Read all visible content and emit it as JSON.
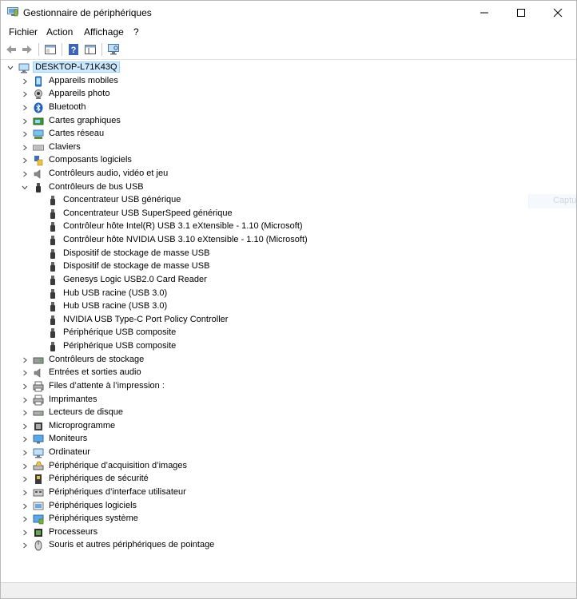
{
  "window": {
    "title": "Gestionnaire de périphériques"
  },
  "menu": [
    "Fichier",
    "Action",
    "Affichage",
    "?"
  ],
  "toolbar": [
    "back-arrow-icon",
    "forward-arrow-icon",
    "properties-icon",
    "help-icon",
    "view-icon",
    "monitor-scan-icon"
  ],
  "tree": {
    "root": "DESKTOP-L71K43Q",
    "categories_before": [
      {
        "label": "Appareils mobiles",
        "icon": "mobile-device-icon"
      },
      {
        "label": "Appareils photo",
        "icon": "camera-icon"
      },
      {
        "label": "Bluetooth",
        "icon": "bluetooth-icon"
      },
      {
        "label": "Cartes graphiques",
        "icon": "display-adapter-icon"
      },
      {
        "label": "Cartes réseau",
        "icon": "network-adapter-icon"
      },
      {
        "label": "Claviers",
        "icon": "keyboard-icon"
      },
      {
        "label": "Composants logiciels",
        "icon": "software-component-icon"
      },
      {
        "label": "Contrôleurs audio, vidéo et jeu",
        "icon": "speaker-icon"
      }
    ],
    "expanded": {
      "label": "Contrôleurs de bus USB",
      "icon": "usb-icon"
    },
    "usb_children": [
      "Concentrateur USB générique",
      "Concentrateur USB SuperSpeed générique",
      "Contrôleur hôte Intel(R) USB 3.1 eXtensible - 1.10 (Microsoft)",
      "Contrôleur hôte NVIDIA USB 3.10 eXtensible - 1.10 (Microsoft)",
      "Dispositif de stockage de masse USB",
      "Dispositif de stockage de masse USB",
      "Genesys Logic USB2.0 Card Reader",
      "Hub USB racine (USB 3.0)",
      "Hub USB racine (USB 3.0)",
      "NVIDIA USB Type-C Port Policy Controller",
      "Périphérique USB composite",
      "Périphérique USB composite"
    ],
    "categories_after": [
      {
        "label": "Contrôleurs de stockage",
        "icon": "storage-controller-icon"
      },
      {
        "label": "Entrées et sorties audio",
        "icon": "speaker-icon"
      },
      {
        "label": "Files d’attente à l’impression :",
        "icon": "printer-icon"
      },
      {
        "label": "Imprimantes",
        "icon": "printer-icon"
      },
      {
        "label": "Lecteurs de disque",
        "icon": "disk-drive-icon"
      },
      {
        "label": "Microprogramme",
        "icon": "firmware-icon"
      },
      {
        "label": "Moniteurs",
        "icon": "monitor-icon"
      },
      {
        "label": "Ordinateur",
        "icon": "computer-icon"
      },
      {
        "label": "Périphérique d’acquisition d’images",
        "icon": "scanner-icon"
      },
      {
        "label": "Périphériques de sécurité",
        "icon": "security-device-icon"
      },
      {
        "label": "Périphériques d’interface utilisateur",
        "icon": "hid-icon"
      },
      {
        "label": "Périphériques logiciels",
        "icon": "software-device-icon"
      },
      {
        "label": "Périphériques système",
        "icon": "system-device-icon"
      },
      {
        "label": "Processeurs",
        "icon": "processor-icon"
      },
      {
        "label": "Souris et autres périphériques de pointage",
        "icon": "mouse-icon"
      }
    ]
  },
  "ghost_text": "Captu"
}
